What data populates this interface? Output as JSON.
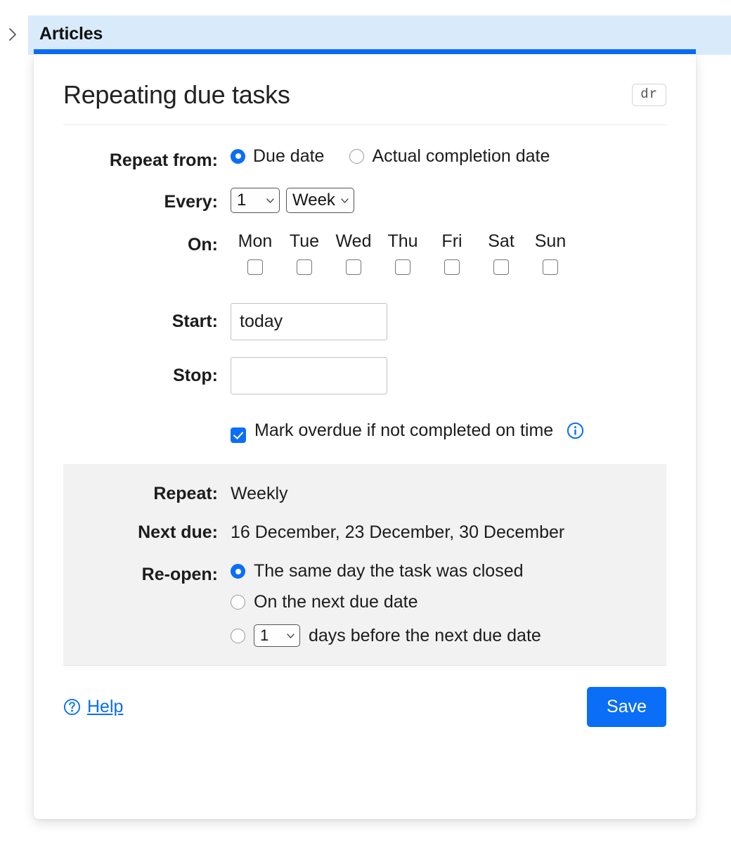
{
  "rail": {
    "toggle_icon": "chevron-right-icon"
  },
  "header": {
    "title": "Articles"
  },
  "card": {
    "title": "Repeating due tasks",
    "shortcut_badge": "dr"
  },
  "form": {
    "repeat_from": {
      "label": "Repeat from:",
      "options": [
        {
          "label": "Due date",
          "selected": true
        },
        {
          "label": "Actual completion date",
          "selected": false
        }
      ]
    },
    "every": {
      "label": "Every:",
      "count_value": "1",
      "unit_value": "Week"
    },
    "on": {
      "label": "On:",
      "days": [
        {
          "name": "Mon",
          "checked": false
        },
        {
          "name": "Tue",
          "checked": false
        },
        {
          "name": "Wed",
          "checked": false
        },
        {
          "name": "Thu",
          "checked": false
        },
        {
          "name": "Fri",
          "checked": false
        },
        {
          "name": "Sat",
          "checked": false
        },
        {
          "name": "Sun",
          "checked": false
        }
      ]
    },
    "start": {
      "label": "Start:",
      "value": "today"
    },
    "stop": {
      "label": "Stop:",
      "value": ""
    },
    "overdue": {
      "label": "Mark overdue if not completed on time",
      "checked": true,
      "info_icon": "info-circle-icon"
    }
  },
  "summary": {
    "repeat": {
      "label": "Repeat:",
      "value": "Weekly"
    },
    "next_due": {
      "label": "Next due:",
      "value": "16 December, 23 December, 30 December"
    },
    "reopen": {
      "label": "Re-open:",
      "options": [
        {
          "label": "The same day the task was closed",
          "selected": true
        },
        {
          "label": "On the next due date",
          "selected": false
        },
        {
          "label": "days before the next due date",
          "selected": false,
          "days_value": "1"
        }
      ]
    }
  },
  "footer": {
    "help_label": "Help",
    "help_icon": "question-circle-icon",
    "save_label": "Save"
  },
  "colors": {
    "accent": "#0b6ef6",
    "header_band": "#d9ebfb",
    "summary_bg": "#f2f2f2"
  }
}
